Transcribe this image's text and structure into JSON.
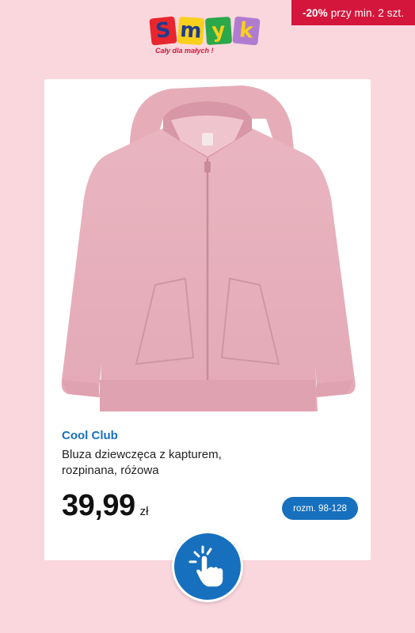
{
  "promo": {
    "discount": "-20%",
    "text": "przy min. 2 szt."
  },
  "logo": {
    "letters": [
      "S",
      "m",
      "y",
      "k"
    ],
    "tile_colors": [
      "#e8262d",
      "#f9d01b",
      "#2aa84a",
      "#b07cd0"
    ],
    "tagline": "Cały dla małych !"
  },
  "product": {
    "brand": "Cool Club",
    "title": "Bluza dziewczęca z kapturem, rozpinana, różowa",
    "price": "39,99",
    "currency": "zł",
    "size_label": "rozm. 98-128",
    "image_icon": "pink-zip-hoodie"
  },
  "action": {
    "icon": "tap-hand-icon"
  },
  "colors": {
    "background": "#f9d7dd",
    "accent_blue": "#1670be",
    "promo_red": "#d4163c"
  }
}
